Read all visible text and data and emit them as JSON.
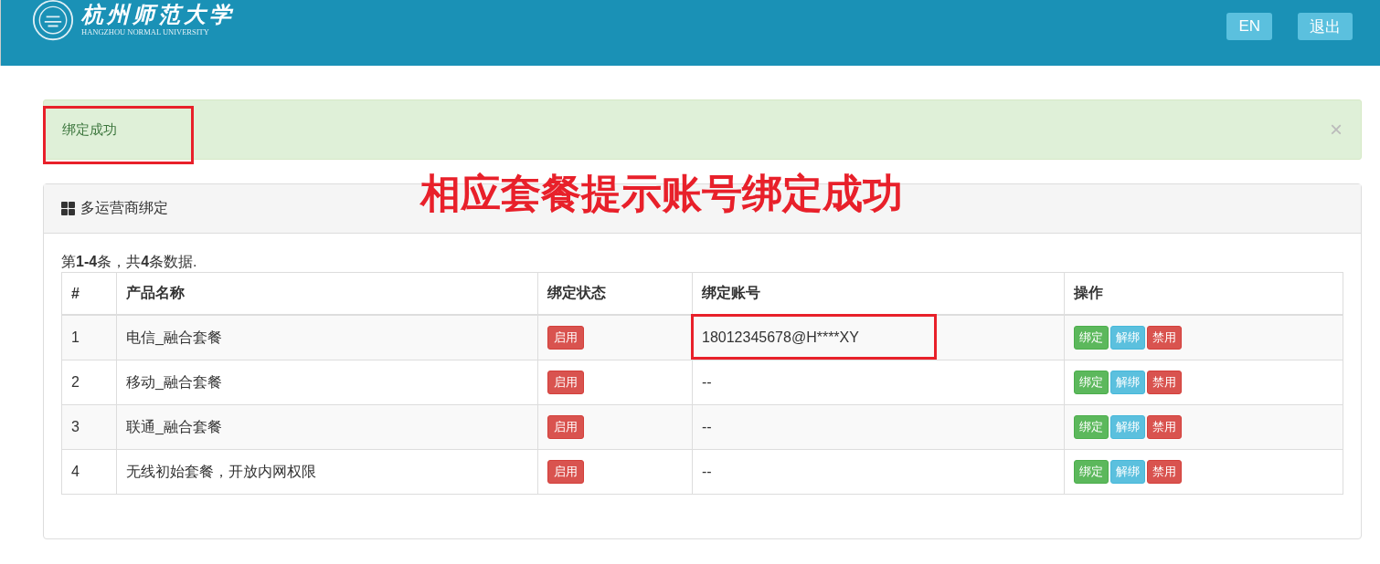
{
  "header": {
    "logo_title": "杭州师范大学",
    "logo_subtitle": "HANGZHOU NORMAL UNIVERSITY",
    "buttons": [
      "EN",
      "退出"
    ]
  },
  "alert": {
    "text": "绑定成功",
    "close": "×",
    "annotated": true
  },
  "annotation": "相应套餐提示账号绑定成功",
  "panel": {
    "title": "多运营商绑定",
    "summary": "第**1-4**条，共**4**条数据.",
    "columns": [
      "#",
      "产品名称",
      "绑定状态",
      "绑定账号",
      "操作"
    ],
    "rows": [
      {
        "index": "1",
        "name": "电信_融合套餐",
        "status": "启用",
        "account": "18012345678@H****XY",
        "annotated": true,
        "actions": [
          {
            "label": "绑定",
            "kind": "success"
          },
          {
            "label": "解绑",
            "kind": "info"
          },
          {
            "label": "禁用",
            "kind": "danger"
          }
        ]
      },
      {
        "index": "2",
        "name": "移动_融合套餐",
        "status": "启用",
        "account": "--",
        "annotated": false,
        "actions": [
          {
            "label": "绑定",
            "kind": "success"
          },
          {
            "label": "解绑",
            "kind": "info"
          },
          {
            "label": "禁用",
            "kind": "danger"
          }
        ]
      },
      {
        "index": "3",
        "name": "联通_融合套餐",
        "status": "启用",
        "account": "--",
        "annotated": false,
        "actions": [
          {
            "label": "绑定",
            "kind": "success"
          },
          {
            "label": "解绑",
            "kind": "info"
          },
          {
            "label": "禁用",
            "kind": "danger"
          }
        ]
      },
      {
        "index": "4",
        "name": "无线初始套餐，开放内网权限",
        "status": "启用",
        "account": "--",
        "annotated": false,
        "actions": [
          {
            "label": "绑定",
            "kind": "success"
          },
          {
            "label": "解绑",
            "kind": "info"
          },
          {
            "label": "禁用",
            "kind": "danger"
          }
        ]
      }
    ]
  }
}
